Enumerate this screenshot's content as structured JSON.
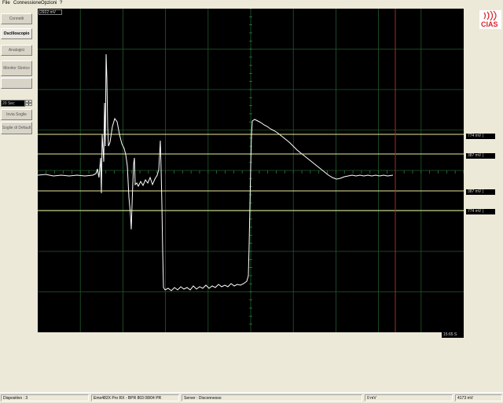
{
  "menu": [
    "File",
    "Connessione",
    "Opzioni",
    "?"
  ],
  "sidebar": {
    "buttons": [
      {
        "label": "Connetti",
        "active": false
      },
      {
        "label": "Oscilloscopio",
        "active": true
      },
      {
        "label": "Analogici",
        "active": false
      },
      {
        "label": "Monitor Storico",
        "active": false
      },
      {
        "label": "",
        "active": false
      }
    ],
    "time_scale": "20 Sec",
    "send_thresholds": "Invia Soglie",
    "default_thresholds": "Soglie di Default"
  },
  "scope": {
    "y_max_label": "2922 mV",
    "time_readout": "15:65 S",
    "ref_lines": [
      {
        "label": "774 mV (",
        "color": "#e8e8a0"
      },
      {
        "label": "387 mV (",
        "color": "#e8e8a0"
      },
      {
        "label": "387 mV (",
        "color": "#e8e8a0"
      },
      {
        "label": "774 mV (",
        "color": "#e8e8a0"
      }
    ],
    "grid_color": "#1f5a2a",
    "trace_color": "#ffffff",
    "cursor_color": "#a03020"
  },
  "logo": {
    "text": "CIAS",
    "color": "#d8232a"
  },
  "status": {
    "device": "Dispositivo : 3",
    "model": "Emo482X Pro RX - BPR 803 08/04 PR",
    "server": "Server : Disconnesso",
    "value1": "0 mV",
    "value2": "4173 mV"
  }
}
